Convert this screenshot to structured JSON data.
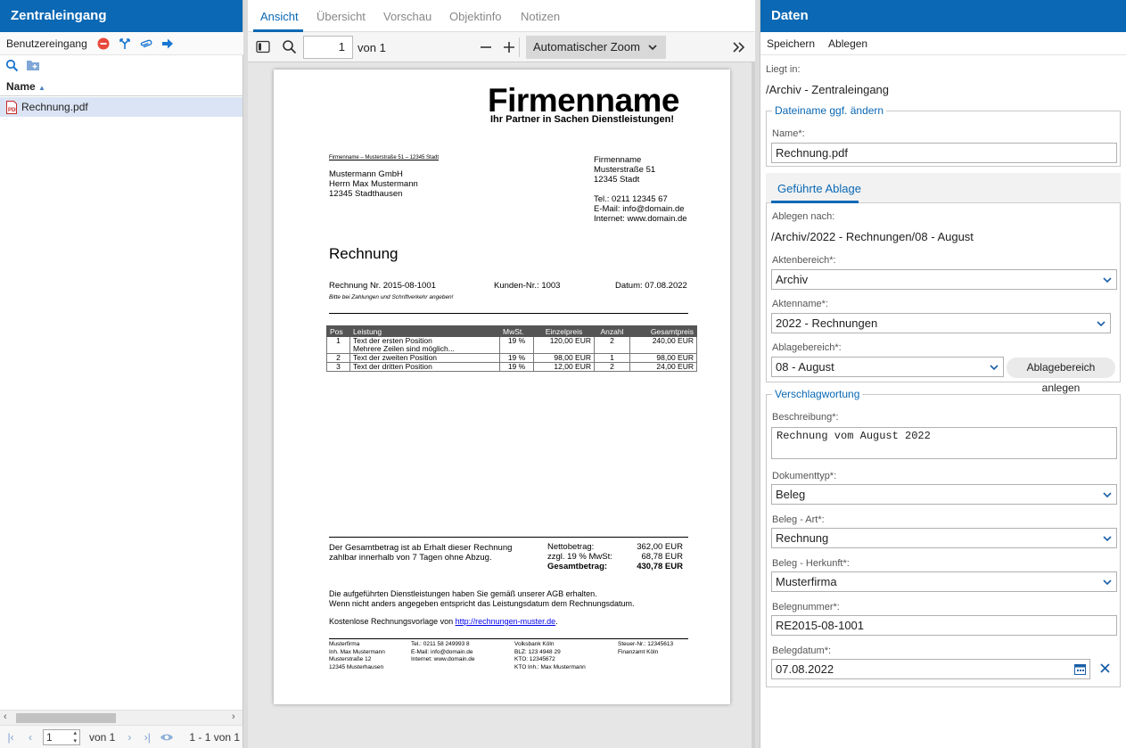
{
  "left": {
    "title": "Zentraleingang",
    "toolbar_label": "Benutzereingang",
    "column_name": "Name",
    "file": "Rechnung.pdf",
    "pager": {
      "page": "1",
      "of": "von 1",
      "range": "1 - 1 von 1"
    }
  },
  "mid": {
    "tabs": [
      "Ansicht",
      "Übersicht",
      "Vorschau",
      "Objektinfo",
      "Notizen"
    ],
    "pdfbar": {
      "page": "1",
      "of": "von 1",
      "zoom": "Automatischer Zoom"
    },
    "doc": {
      "company": "Firmenname",
      "slogan": "Ihr Partner in Sachen Dienstleistungen!",
      "sender_line": "Firmenname – Musterstraße 51 – 12345 Stadt",
      "recipient": [
        "Mustermann GmbH",
        "Herrn Max Mustermann",
        "12345 Stadthausen"
      ],
      "sender_block": [
        "Firmenname",
        "Musterstraße 51",
        "12345 Stadt",
        "",
        "Tel.: 0211 12345 67",
        "E-Mail: info@domain.de",
        "Internet: www.domain.de"
      ],
      "heading": "Rechnung",
      "invoice_no": "Rechnung Nr. 2015-08-1001",
      "customer_no": "Kunden-Nr.: 1003",
      "date": "Datum: 07.08.2022",
      "note": "Bitte bei Zahlungen und Schriftverkehr angeben!",
      "table_headers": [
        "Pos",
        "Leistung",
        "MwSt.",
        "Einzelpreis",
        "Anzahl",
        "Gesamtpreis"
      ],
      "rows": [
        {
          "pos": "1",
          "text": "Text der ersten Position",
          "text2": "Mehrere Zeilen sind möglich...",
          "vat": "19 %",
          "unit": "120,00 EUR",
          "qty": "2",
          "total": "240,00 EUR"
        },
        {
          "pos": "2",
          "text": "Text der zweiten Position",
          "text2": "",
          "vat": "19 %",
          "unit": "98,00 EUR",
          "qty": "1",
          "total": "98,00 EUR"
        },
        {
          "pos": "3",
          "text": "Text der dritten Position",
          "text2": "",
          "vat": "19 %",
          "unit": "12,00 EUR",
          "qty": "2",
          "total": "24,00 EUR"
        }
      ],
      "payment": [
        "Der Gesamtbetrag ist ab Erhalt dieser Rechnung",
        "zahlbar innerhalb von 7 Tagen ohne Abzug."
      ],
      "netto_label": "Nettobetrag:",
      "netto": "362,00 EUR",
      "vat_label": "zzgl. 19 % MwSt:",
      "vat": "68,78 EUR",
      "gross_label": "Gesamtbetrag:",
      "gross": "430,78 EUR",
      "agb": [
        "Die aufgeführten Dienstleistungen haben Sie gemäß unserer AGB erhalten.",
        "Wenn nicht anders angegeben entspricht das Leistungsdatum dem Rechnungsdatum."
      ],
      "template_text": "Kostenlose Rechnungsvorlage von ",
      "template_link": "http://rechnungen-muster.de",
      "footer": [
        [
          "Musterfirma",
          "Inh. Max Mustermann",
          "Musterstraße 12",
          "12345 Musterhausen"
        ],
        [
          "Tel.: 0211 58 249993 8",
          "E-Mail: info@domain.de",
          "Internet: www.domain.de"
        ],
        [
          "Volksbank Köln",
          "BLZ: 123 4948 29",
          "KTO: 12345672",
          "KTO Inh.: Max Mustermann"
        ],
        [
          "Steuer-Nr.: 12345613",
          "Finanzamt Köln"
        ]
      ]
    }
  },
  "right": {
    "title": "Daten",
    "menu": [
      "Speichern",
      "Ablegen"
    ],
    "location_label": "Liegt in:",
    "location": "/Archiv - Zentraleingang",
    "fs1_legend": "Dateiname ggf. ändern",
    "name_label": "Name*:",
    "name_value": "Rechnung.pdf",
    "ga_tab": "Geführte Ablage",
    "target_label": "Ablegen nach:",
    "target": "/Archiv/2022 - Rechnungen/08 - August",
    "aktenbereich_label": "Aktenbereich*:",
    "aktenbereich": "Archiv",
    "aktenname_label": "Aktenname*:",
    "aktenname": "2022 - Rechnungen",
    "ablagebereich_label": "Ablagebereich*:",
    "ablagebereich": "08 - August",
    "create_btn": "Ablagebereich anlegen",
    "fs2_legend": "Verschlagwortung",
    "desc_label": "Beschreibung*:",
    "desc": "Rechnung vom August 2022",
    "doctype_label": "Dokumenttyp*:",
    "doctype": "Beleg",
    "art_label": "Beleg - Art*:",
    "art": "Rechnung",
    "herkunft_label": "Beleg - Herkunft*:",
    "herkunft": "Musterfirma",
    "belegnr_label": "Belegnummer*:",
    "belegnr": "RE2015-08-1001",
    "belegdatum_label": "Belegdatum*:",
    "belegdatum": "07.08.2022"
  }
}
